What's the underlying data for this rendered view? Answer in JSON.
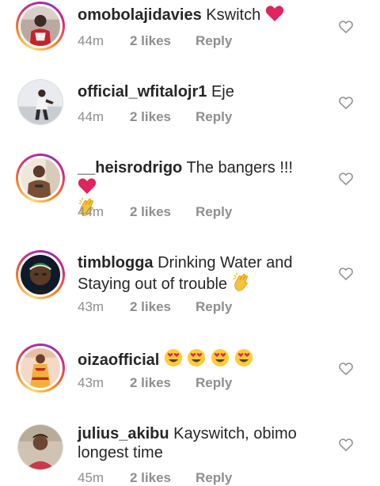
{
  "comments": [
    {
      "username": "omobolajidavies",
      "text": "Kswitch",
      "emoji": [
        "red-heart"
      ],
      "time": "44m",
      "likes": "2 likes",
      "reply": "Reply"
    },
    {
      "username": "official_wfitalojr1",
      "text": "Eje",
      "emoji": [],
      "time": "44m",
      "likes": "2 likes",
      "reply": "Reply"
    },
    {
      "username": "__heisrodrigo",
      "text": "The bangers !!!",
      "emoji": [
        "red-heart",
        "clapping-hands"
      ],
      "time": "44m",
      "likes": "2 likes",
      "reply": "Reply"
    },
    {
      "username": "timblogga",
      "text": "Drinking Water and Staying out of trouble",
      "emoji": [
        "clapping-hands"
      ],
      "time": "43m",
      "likes": "2 likes",
      "reply": "Reply"
    },
    {
      "username": "oizaofficial",
      "text": "",
      "emoji": [
        "heart-eyes",
        "heart-eyes",
        "heart-eyes",
        "heart-eyes"
      ],
      "time": "43m",
      "likes": "2 likes",
      "reply": "Reply"
    },
    {
      "username": "julius_akibu",
      "text": "Kayswitch, obimo longest time",
      "emoji": [],
      "time": "45m",
      "likes": "2 likes",
      "reply": "Reply"
    }
  ],
  "colors": {
    "text": "#262626",
    "meta": "#8e8e8e",
    "heart_emoji": "#e0245e",
    "story_ring_start": "#feda75",
    "story_ring_end": "#962fbf"
  }
}
